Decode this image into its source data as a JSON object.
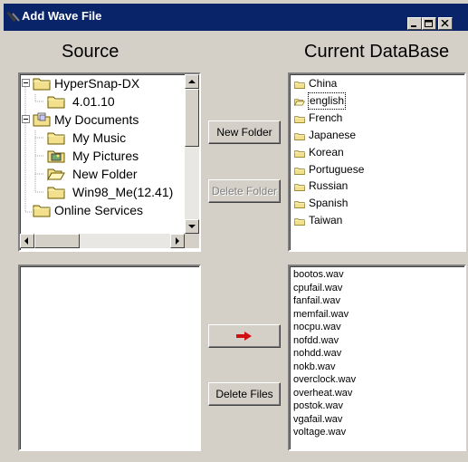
{
  "window": {
    "title": "Add Wave File",
    "minimize_label": "Minimize",
    "maximize_label": "Maximize",
    "close_label": "Close"
  },
  "source": {
    "heading": "Source",
    "tree": [
      {
        "label": "HyperSnap-DX",
        "icon": "folder-icon",
        "expanded": true
      },
      {
        "label": "4.01.10",
        "icon": "folder-icon"
      },
      {
        "label": "My Documents",
        "icon": "documents-folder-icon",
        "expanded": true
      },
      {
        "label": "My Music",
        "icon": "folder-icon"
      },
      {
        "label": "My Pictures",
        "icon": "pictures-folder-icon"
      },
      {
        "label": "New Folder",
        "icon": "open-folder-icon"
      },
      {
        "label": "Win98_Me(12.41)",
        "icon": "folder-icon"
      },
      {
        "label": "Online Services",
        "icon": "folder-icon"
      }
    ],
    "files": []
  },
  "database": {
    "heading": "Current DataBase",
    "folders": [
      {
        "label": "China",
        "icon": "folder-icon"
      },
      {
        "label": "english",
        "icon": "open-folder-icon",
        "selected": true
      },
      {
        "label": "French",
        "icon": "folder-icon"
      },
      {
        "label": "Japanese",
        "icon": "folder-icon"
      },
      {
        "label": "Korean",
        "icon": "folder-icon"
      },
      {
        "label": "Portuguese",
        "icon": "folder-icon"
      },
      {
        "label": "Russian",
        "icon": "folder-icon"
      },
      {
        "label": "Spanish",
        "icon": "folder-icon"
      },
      {
        "label": "Taiwan",
        "icon": "folder-icon"
      }
    ],
    "files": [
      "bootos.wav",
      "cpufail.wav",
      "fanfail.wav",
      "memfail.wav",
      "nocpu.wav",
      "nofdd.wav",
      "nohdd.wav",
      "nokb.wav",
      "overclock.wav",
      "overheat.wav",
      "postok.wav",
      "vgafail.wav",
      "voltage.wav"
    ]
  },
  "buttons": {
    "new_folder": "New Folder",
    "delete_folder": "Delete Folder",
    "add_arrow_icon": "right-arrow-icon",
    "delete_files": "Delete Files"
  },
  "colors": {
    "titlebar": "#0a246a",
    "face": "#d4d0c8",
    "folder": "#f2e08c",
    "arrow": "#d01010"
  }
}
